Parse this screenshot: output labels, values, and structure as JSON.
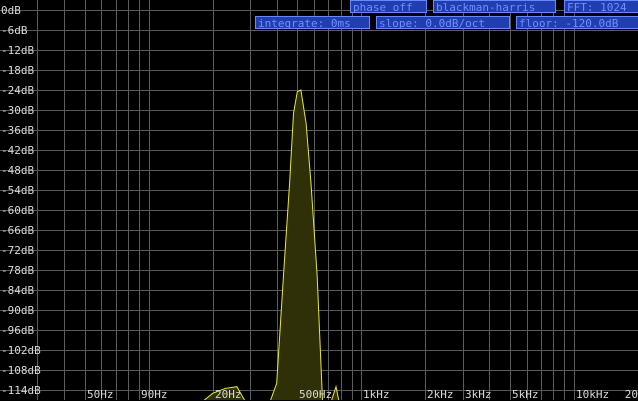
{
  "toolbar": {
    "phase": "phase off",
    "window": "blackman-harris",
    "fft": "FFT: 1024",
    "integrate": "integrate: 0ms",
    "slope": "slope: 0.0dB/oct",
    "floor": "floor: -120.0dB"
  },
  "colors": {
    "background": "#000000",
    "grid": "#5a5a5a",
    "trace": "#e8e83a",
    "trace_fill": "#2f2f08",
    "badge_bg": "#1f3fb0",
    "badge_text": "#6f8fff"
  },
  "chart_data": {
    "type": "area",
    "x_scale": "log",
    "xlim": [
      20,
      20000
    ],
    "ylim": [
      -117,
      3
    ],
    "y_ticks": [
      0,
      -6,
      -12,
      -18,
      -24,
      -30,
      -36,
      -42,
      -48,
      -54,
      -60,
      -66,
      -72,
      -78,
      -84,
      -90,
      -96,
      -102,
      -108,
      -114
    ],
    "y_tick_labels": [
      "0dB",
      "-6dB",
      "-12dB",
      "-18dB",
      "-24dB",
      "-30dB",
      "-36dB",
      "-42dB",
      "-48dB",
      "-54dB",
      "-60dB",
      "-66dB",
      "-72dB",
      "-78dB",
      "-84dB",
      "-90dB",
      "-96dB",
      "-102dB",
      "-108dB",
      "-114dB"
    ],
    "x_ticks": [
      50,
      90,
      200,
      500,
      1000,
      2000,
      3000,
      5000,
      10000
    ],
    "x_tick_labels": [
      "50Hz",
      "90Hz",
      "20Hz",
      "500Hz",
      "1kHz",
      "2kHz",
      "3kHz",
      "5kHz",
      "10kHz",
      "20"
    ],
    "x_gridlines": [
      30,
      40,
      50,
      60,
      70,
      80,
      90,
      100,
      200,
      300,
      400,
      500,
      600,
      700,
      800,
      900,
      1000,
      2000,
      3000,
      4000,
      5000,
      6000,
      7000,
      8000,
      9000,
      10000,
      20000
    ],
    "grid": true,
    "series": [
      {
        "x": [
          160,
          200,
          230,
          260,
          300,
          360,
          400,
          430,
          460,
          480,
          500,
          520,
          550,
          580,
          620,
          660,
          700,
          760,
          800
        ],
        "y": [
          -120,
          -115,
          -113.5,
          -113,
          -120,
          -120,
          -112,
          -80,
          -52,
          -31,
          -24.5,
          -24,
          -34,
          -52,
          -80,
          -120,
          -120,
          -113,
          -120
        ]
      }
    ]
  }
}
